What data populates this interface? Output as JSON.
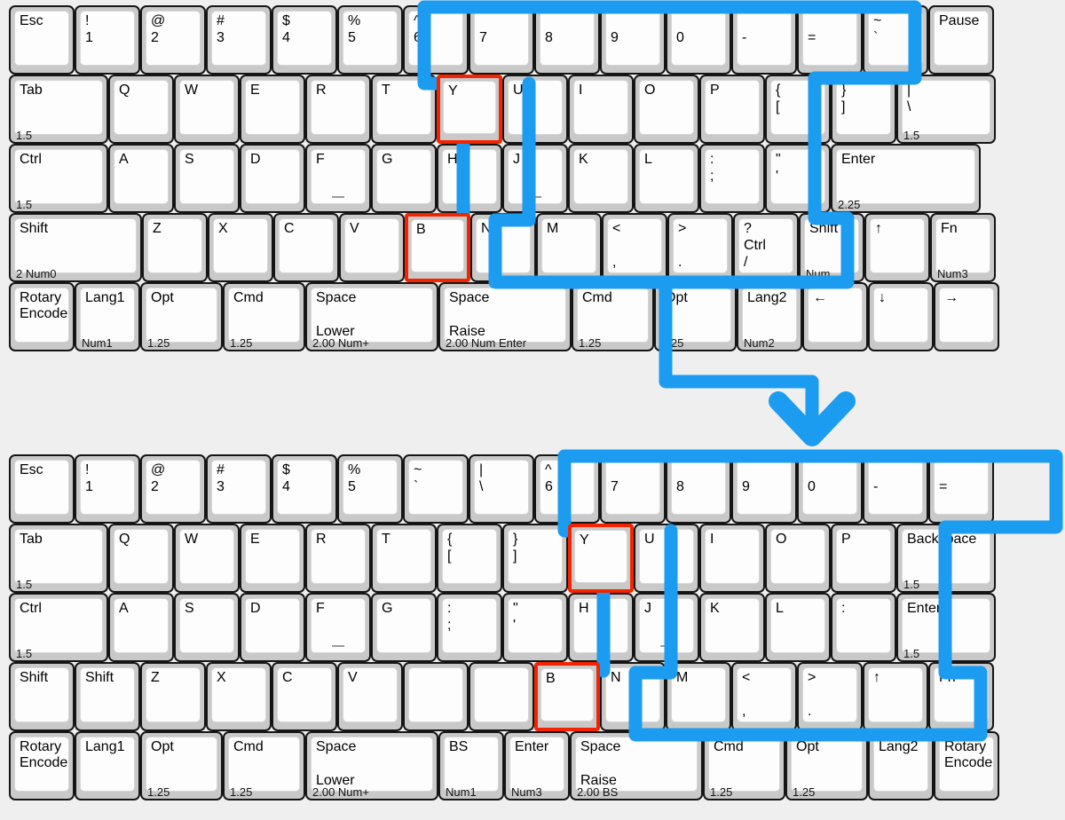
{
  "meta": {
    "highlight_color": "#f42400",
    "path_color": "#1b9cf0",
    "background": "#efefef",
    "key_face": "#fdfdfd",
    "key_body": "#c9c9c9"
  },
  "keyboards": [
    {
      "id": "top-layout",
      "name": "original-layout",
      "rows": [
        {
          "name": "number-row",
          "keys": [
            {
              "l1": "Esc",
              "u": 1
            },
            {
              "l1": "!",
              "l2": "1",
              "u": 1
            },
            {
              "l1": "@",
              "l2": "2",
              "u": 1
            },
            {
              "l1": "#",
              "l2": "3",
              "u": 1
            },
            {
              "l1": "$",
              "l2": "4",
              "u": 1
            },
            {
              "l1": "%",
              "l2": "5",
              "u": 1
            },
            {
              "l1": "^",
              "l2": "6",
              "u": 1,
              "path": true
            },
            {
              "l1": "",
              "l2": "7",
              "u": 1,
              "path": true
            },
            {
              "l1": "",
              "l2": "8",
              "u": 1,
              "path": true
            },
            {
              "l1": "",
              "l2": "9",
              "u": 1,
              "path": true
            },
            {
              "l1": "",
              "l2": "0",
              "u": 1,
              "path": true
            },
            {
              "l1": "",
              "l2": "-",
              "u": 1,
              "path": true
            },
            {
              "l1": "",
              "l2": "=",
              "u": 1,
              "path": true
            },
            {
              "l1": "~",
              "l2": "`",
              "u": 1
            },
            {
              "l1": "Pause",
              "u": 1
            }
          ]
        },
        {
          "name": "qwerty-row",
          "keys": [
            {
              "l1": "Tab",
              "u": 1.5,
              "size": "1.5"
            },
            {
              "l1": "Q",
              "u": 1
            },
            {
              "l1": "W",
              "u": 1
            },
            {
              "l1": "E",
              "u": 1
            },
            {
              "l1": "R",
              "u": 1
            },
            {
              "l1": "T",
              "u": 1
            },
            {
              "l1": "Y",
              "u": 1,
              "highlight": true
            },
            {
              "l1": "U",
              "u": 1
            },
            {
              "l1": "I",
              "u": 1
            },
            {
              "l1": "O",
              "u": 1
            },
            {
              "l1": "P",
              "u": 1
            },
            {
              "l1": "{",
              "l2": "[",
              "u": 1
            },
            {
              "l1": "}",
              "l2": "]",
              "u": 1
            },
            {
              "l1": "|",
              "l2": "\\",
              "u": 1.5,
              "size": "1.5"
            }
          ]
        },
        {
          "name": "home-row",
          "keys": [
            {
              "l1": "Ctrl",
              "u": 1.5,
              "size": "1.5"
            },
            {
              "l1": "A",
              "u": 1
            },
            {
              "l1": "S",
              "u": 1
            },
            {
              "l1": "D",
              "u": 1
            },
            {
              "l1": "F",
              "u": 1,
              "homebump": true
            },
            {
              "l1": "G",
              "u": 1
            },
            {
              "l1": "H",
              "u": 1
            },
            {
              "l1": "J",
              "u": 1,
              "homebump": true
            },
            {
              "l1": "K",
              "u": 1
            },
            {
              "l1": "L",
              "u": 1
            },
            {
              "l1": ":",
              "l2": ";",
              "u": 1
            },
            {
              "l1": "\"",
              "l2": "'",
              "u": 1
            },
            {
              "l1": "Enter",
              "u": 2.25,
              "size": "2.25"
            }
          ]
        },
        {
          "name": "shift-row",
          "keys": [
            {
              "l1": "Shift",
              "u": 2,
              "size": "2 Num0"
            },
            {
              "l1": "Z",
              "u": 1
            },
            {
              "l1": "X",
              "u": 1
            },
            {
              "l1": "C",
              "u": 1
            },
            {
              "l1": "V",
              "u": 1
            },
            {
              "l1": "B",
              "u": 1,
              "highlight": true
            },
            {
              "l1": "N",
              "u": 1
            },
            {
              "l1": "M",
              "u": 1
            },
            {
              "l1": "<",
              "l2": ",",
              "u": 1,
              "l2pos": "l3"
            },
            {
              "l1": ">",
              "l2": ".",
              "u": 1,
              "l2pos": "l3"
            },
            {
              "l1": "?",
              "l2": "Ctrl",
              "l3": "/",
              "u": 1
            },
            {
              "l1": "Shift",
              "u": 1,
              "size": "Num."
            },
            {
              "l1": "↑",
              "u": 1
            },
            {
              "l1": "Fn",
              "u": 1,
              "size": "Num3"
            }
          ]
        },
        {
          "name": "modifier-row",
          "keys": [
            {
              "l1": "Rotary\nEncoder",
              "u": 1,
              "twoline": true
            },
            {
              "l1": "Lang1",
              "u": 1,
              "size": "Num1"
            },
            {
              "l1": "Opt",
              "u": 1.25,
              "size": "1.25"
            },
            {
              "l1": "Cmd",
              "u": 1.25,
              "size": "1.25"
            },
            {
              "l1": "Space",
              "l2": "Lower",
              "u": 2,
              "size": "2.00 Num+",
              "l2pos": "l3"
            },
            {
              "l1": "Space",
              "l2": "Raise",
              "u": 2,
              "size": "2.00 Num Enter",
              "l2pos": "l3"
            },
            {
              "l1": "Cmd",
              "u": 1.25,
              "size": "1.25"
            },
            {
              "l1": "Opt",
              "u": 1.25,
              "size": "1.25"
            },
            {
              "l1": "Lang2",
              "u": 1,
              "size": "Num2"
            },
            {
              "l1": "←",
              "u": 1
            },
            {
              "l1": "↓",
              "u": 1
            },
            {
              "l1": "→",
              "u": 1
            }
          ]
        }
      ]
    },
    {
      "id": "bottom-layout",
      "name": "revised-layout",
      "rows": [
        {
          "name": "number-row",
          "keys": [
            {
              "l1": "Esc",
              "u": 1
            },
            {
              "l1": "!",
              "l2": "1",
              "u": 1
            },
            {
              "l1": "@",
              "l2": "2",
              "u": 1
            },
            {
              "l1": "#",
              "l2": "3",
              "u": 1
            },
            {
              "l1": "$",
              "l2": "4",
              "u": 1
            },
            {
              "l1": "%",
              "l2": "5",
              "u": 1
            },
            {
              "l1": "~",
              "l2": "`",
              "u": 1
            },
            {
              "l1": "|",
              "l2": "\\",
              "u": 1
            },
            {
              "l1": "^",
              "l2": "6",
              "u": 1,
              "path": true
            },
            {
              "l1": "",
              "l2": "7",
              "u": 1,
              "path": true
            },
            {
              "l1": "",
              "l2": "8",
              "u": 1,
              "path": true
            },
            {
              "l1": "",
              "l2": "9",
              "u": 1,
              "path": true
            },
            {
              "l1": "",
              "l2": "0",
              "u": 1,
              "path": true
            },
            {
              "l1": "",
              "l2": "-",
              "u": 1,
              "path": true
            },
            {
              "l1": "",
              "l2": "=",
              "u": 1,
              "path": true
            }
          ]
        },
        {
          "name": "qwerty-row",
          "keys": [
            {
              "l1": "Tab",
              "u": 1.5,
              "size": "1.5"
            },
            {
              "l1": "Q",
              "u": 1
            },
            {
              "l1": "W",
              "u": 1
            },
            {
              "l1": "E",
              "u": 1
            },
            {
              "l1": "R",
              "u": 1
            },
            {
              "l1": "T",
              "u": 1
            },
            {
              "l1": "{",
              "l2": "[",
              "u": 1
            },
            {
              "l1": "}",
              "l2": "]",
              "u": 1
            },
            {
              "l1": "Y",
              "u": 1,
              "highlight": true
            },
            {
              "l1": "U",
              "u": 1
            },
            {
              "l1": "I",
              "u": 1
            },
            {
              "l1": "O",
              "u": 1
            },
            {
              "l1": "P",
              "u": 1
            },
            {
              "l1": "Backspace",
              "u": 1.5,
              "size": "1.5"
            }
          ]
        },
        {
          "name": "home-row",
          "keys": [
            {
              "l1": "Ctrl",
              "u": 1.5,
              "size": "1.5"
            },
            {
              "l1": "A",
              "u": 1
            },
            {
              "l1": "S",
              "u": 1
            },
            {
              "l1": "D",
              "u": 1
            },
            {
              "l1": "F",
              "u": 1,
              "homebump": true
            },
            {
              "l1": "G",
              "u": 1
            },
            {
              "l1": ":",
              "l2": ";",
              "u": 1
            },
            {
              "l1": "\"",
              "l2": "'",
              "u": 1
            },
            {
              "l1": "H",
              "u": 1
            },
            {
              "l1": "J",
              "u": 1,
              "homebump": true
            },
            {
              "l1": "K",
              "u": 1
            },
            {
              "l1": "L",
              "u": 1
            },
            {
              "l1": ":",
              "u": 1
            },
            {
              "l1": "Enter",
              "u": 1.5,
              "size": "1.5"
            }
          ]
        },
        {
          "name": "shift-row",
          "keys": [
            {
              "l1": "Shift",
              "u": 1
            },
            {
              "l1": "Shift",
              "u": 1
            },
            {
              "l1": "Z",
              "u": 1
            },
            {
              "l1": "X",
              "u": 1
            },
            {
              "l1": "C",
              "u": 1
            },
            {
              "l1": "V",
              "u": 1
            },
            {
              "l1": "",
              "u": 1
            },
            {
              "l1": "",
              "u": 1
            },
            {
              "l1": "B",
              "u": 1,
              "highlight": true
            },
            {
              "l1": "N",
              "u": 1
            },
            {
              "l1": "M",
              "u": 1
            },
            {
              "l1": "<",
              "l2": ",",
              "u": 1,
              "l2pos": "l3"
            },
            {
              "l1": ">",
              "l2": ".",
              "u": 1,
              "l2pos": "l3"
            },
            {
              "l1": "↑",
              "u": 1
            },
            {
              "l1": "Fn",
              "u": 1
            }
          ]
        },
        {
          "name": "modifier-row",
          "keys": [
            {
              "l1": "Rotary\nEncoder",
              "u": 1,
              "twoline": true
            },
            {
              "l1": "Lang1",
              "u": 1
            },
            {
              "l1": "Opt",
              "u": 1.25,
              "size": "1.25"
            },
            {
              "l1": "Cmd",
              "u": 1.25,
              "size": "1.25"
            },
            {
              "l1": "Space",
              "l2": "Lower",
              "u": 2,
              "size": "2.00 Num+",
              "l2pos": "l3"
            },
            {
              "l1": "BS",
              "u": 1,
              "size": "Num1"
            },
            {
              "l1": "Enter",
              "u": 1,
              "size": "Num3"
            },
            {
              "l1": "Space",
              "l2": "Raise",
              "u": 2,
              "size": "2.00 BS",
              "l2pos": "l3"
            },
            {
              "l1": "Cmd",
              "u": 1.25,
              "size": "1.25"
            },
            {
              "l1": "Opt",
              "u": 1.25,
              "size": "1.25"
            },
            {
              "l1": "Lang2",
              "u": 1
            },
            {
              "l1": "Rotary\nEncoder",
              "u": 1,
              "twoline": true
            }
          ]
        }
      ]
    }
  ]
}
